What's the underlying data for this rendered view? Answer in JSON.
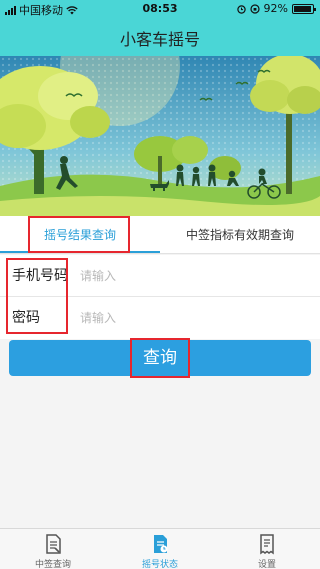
{
  "status_bar": {
    "carrier": "中国移动",
    "time": "08:53",
    "battery_text": "92%",
    "battery_level": 0.92
  },
  "nav": {
    "title": "小客车摇号"
  },
  "tabs": [
    {
      "label": "摇号结果查询",
      "active": true
    },
    {
      "label": "中签指标有效期查询",
      "active": false
    }
  ],
  "form": {
    "phone": {
      "label": "手机号码",
      "placeholder": "请输入",
      "value": ""
    },
    "password": {
      "label": "密码",
      "placeholder": "请输入",
      "value": ""
    }
  },
  "query_button": {
    "label": "查询"
  },
  "bottom_tabs": [
    {
      "label": "中签查询",
      "icon": "document-list-icon",
      "active": false
    },
    {
      "label": "摇号状态",
      "icon": "document-status-icon",
      "active": true
    },
    {
      "label": "设置",
      "icon": "receipt-icon",
      "active": false
    }
  ],
  "colors": {
    "nav_bg": "#4ad6d6",
    "accent": "#2a9fd8",
    "button_bg": "#2c9fe0",
    "annotation_red": "#e6262e"
  }
}
